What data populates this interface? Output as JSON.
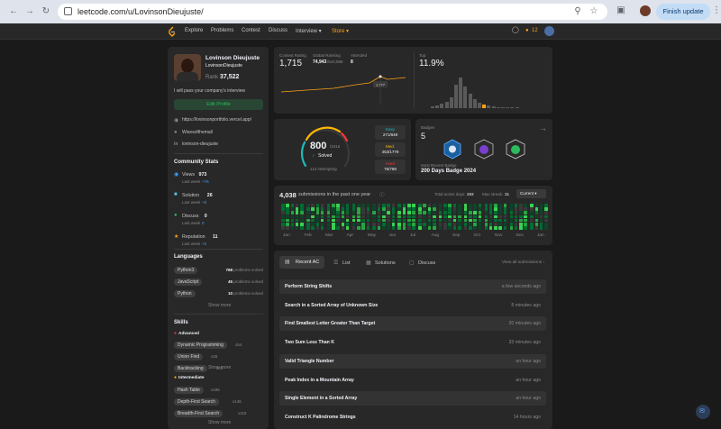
{
  "browser": {
    "url": "leetcode.com/u/LovinsonDieujuste/",
    "finish_update": "Finish update"
  },
  "nav": {
    "items": [
      "Explore",
      "Problems",
      "Contest",
      "Discuss",
      "Interview ▾",
      "Store ▾"
    ],
    "coins": "12"
  },
  "profile": {
    "name": "Lovinson Dieujuste",
    "username": "LovinsonDieujuste",
    "rank_label": "Rank",
    "rank": "37,522",
    "bio": "I will pass your company's interview",
    "edit_button": "Edit Profile",
    "website": "https://lovinsonportfolio.vercel.app/",
    "github": "Wisesofthemall",
    "linkedin": "lovinson-dieujuste"
  },
  "community": {
    "title": "Community Stats",
    "stats": [
      {
        "label": "Views",
        "value": "973",
        "week_label": "Last week",
        "delta": "+76",
        "color": "#3ea3ff"
      },
      {
        "label": "Solution",
        "value": "26",
        "week_label": "Last week",
        "delta": "+0",
        "color": "#5bc0eb"
      },
      {
        "label": "Discuss",
        "value": "0",
        "week_label": "Last week",
        "delta": "0",
        "color": "#2cbb5d"
      },
      {
        "label": "Reputation",
        "value": "11",
        "week_label": "Last week",
        "delta": "+2",
        "color": "#ffa116"
      }
    ]
  },
  "languages": {
    "title": "Languages",
    "items": [
      {
        "name": "Python3",
        "count": "768",
        "suffix": "problems solved"
      },
      {
        "name": "JavaScript",
        "count": "45",
        "suffix": "problems solved"
      },
      {
        "name": "Python",
        "count": "10",
        "suffix": "problems solved"
      }
    ],
    "show_more": "Show more"
  },
  "skills": {
    "title": "Skills",
    "advanced_label": "Advanced",
    "advanced": [
      {
        "name": "Dynamic Programming",
        "count": "x54"
      },
      {
        "name": "Union Find",
        "count": "x26"
      },
      {
        "name": "Backtracking",
        "count": "x29"
      }
    ],
    "show_more_1": "Show more",
    "intermediate_label": "Intermediate",
    "intermediate": [
      {
        "name": "Hash Table",
        "count": "x186"
      },
      {
        "name": "Depth-First Search",
        "count": "x146"
      },
      {
        "name": "Breadth-First Search",
        "count": "x118"
      }
    ],
    "show_more_2": "Show more"
  },
  "contest": {
    "rating_label": "Contest Rating",
    "rating": "1,715",
    "global_label": "Global Ranking",
    "global_rank": "74,943",
    "global_total": "/644,986",
    "attended_label": "Attended",
    "attended": "8",
    "tooltip": "1,777",
    "top_label": "Top",
    "top": "11.9%"
  },
  "solved": {
    "count": "800",
    "total": "/3416",
    "label": "Solved",
    "attempting": "113 Attempting",
    "easy_label": "Easy",
    "easy": "271/849",
    "med_label": "Med.",
    "med": "453/1779",
    "hard_label": "Hard",
    "hard": "76/788"
  },
  "badges": {
    "title": "Badges",
    "count": "5",
    "recent_label": "Most Recent Badge",
    "recent": "200 Days Badge 2024"
  },
  "calendar": {
    "submissions": "4,038",
    "submissions_label": "submissions in the past one year",
    "active_label": "Total active days:",
    "active": "293",
    "streak_label": "Max streak:",
    "streak": "31",
    "current": "Current ▾",
    "months": [
      "Jan",
      "Feb",
      "Mar",
      "Apr",
      "May",
      "Jun",
      "Jul",
      "Aug",
      "Sep",
      "Oct",
      "Nov",
      "Dec",
      "Jan"
    ]
  },
  "tabs": {
    "recent": "Recent AC",
    "list": "List",
    "solutions": "Solutions",
    "discuss": "Discuss",
    "view_all": "View all submissions ›"
  },
  "recent_ac": [
    {
      "title": "Perform String Shifts",
      "ago": "a few seconds ago"
    },
    {
      "title": "Search in a Sorted Array of Unknown Size",
      "ago": "8 minutes ago"
    },
    {
      "title": "Find Smallest Letter Greater Than Target",
      "ago": "20 minutes ago"
    },
    {
      "title": "Two Sum Less Than K",
      "ago": "33 minutes ago"
    },
    {
      "title": "Valid Triangle Number",
      "ago": "an hour ago"
    },
    {
      "title": "Peak Index in a Mountain Array",
      "ago": "an hour ago"
    },
    {
      "title": "Single Element in a Sorted Array",
      "ago": "an hour ago"
    },
    {
      "title": "Construct K Palindrome Strings",
      "ago": "14 hours ago"
    }
  ],
  "colors": {
    "accent": "#ffa116",
    "easy": "#1cbaba",
    "medium": "#ffb800",
    "hard": "#f63737",
    "green": "#2cbb5d"
  }
}
